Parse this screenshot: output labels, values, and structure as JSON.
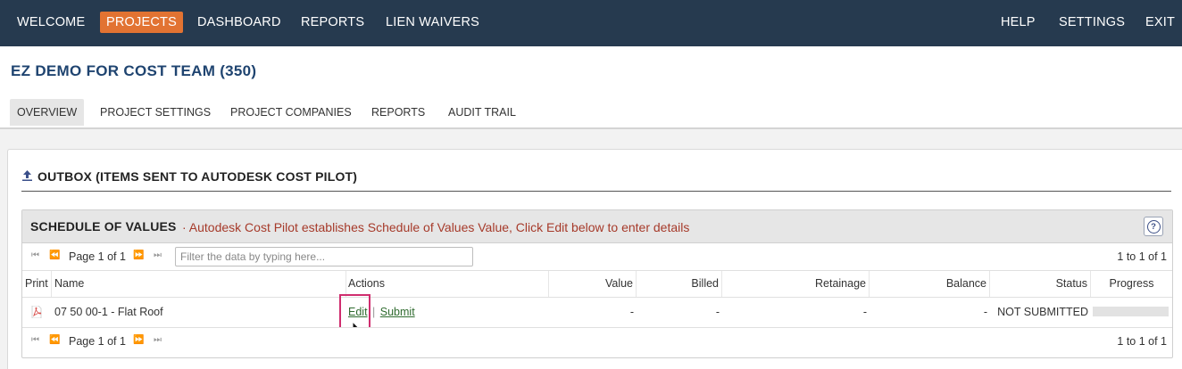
{
  "topnav": {
    "items": [
      {
        "label": "WELCOME",
        "active": false
      },
      {
        "label": "PROJECTS",
        "active": true
      },
      {
        "label": "DASHBOARD",
        "active": false
      },
      {
        "label": "REPORTS",
        "active": false
      },
      {
        "label": "LIEN WAIVERS",
        "active": false
      }
    ],
    "right_items": [
      {
        "label": "HELP"
      },
      {
        "label": "SETTINGS"
      },
      {
        "label": "EXIT"
      }
    ],
    "bg_color": "#263a4f",
    "active_color": "#e27332"
  },
  "project": {
    "title": "EZ DEMO FOR COST TEAM (350)"
  },
  "subtabs": [
    {
      "label": "OVERVIEW",
      "active": true
    },
    {
      "label": "PROJECT SETTINGS",
      "active": false
    },
    {
      "label": "PROJECT COMPANIES",
      "active": false
    },
    {
      "label": "REPORTS",
      "active": false
    },
    {
      "label": "AUDIT TRAIL",
      "active": false
    }
  ],
  "outbox": {
    "icon": "upload-icon",
    "title": "OUTBOX (ITEMS SENT TO AUTODESK COST PILOT)"
  },
  "sov": {
    "title": "SCHEDULE OF VALUES",
    "description": "· Autodesk Cost Pilot establishes Schedule of Values Value, Click Edit below to enter details",
    "help_icon": "question-circle-icon",
    "pager": {
      "page_label": "Page 1 of 1",
      "range_label": "1 to 1 of 1",
      "filter_placeholder": "Filter the data by typing here...",
      "filter_value": ""
    },
    "columns": [
      {
        "key": "print",
        "label": "Print"
      },
      {
        "key": "name",
        "label": "Name"
      },
      {
        "key": "actions",
        "label": "Actions"
      },
      {
        "key": "value",
        "label": "Value"
      },
      {
        "key": "billed",
        "label": "Billed"
      },
      {
        "key": "retainage",
        "label": "Retainage"
      },
      {
        "key": "balance",
        "label": "Balance"
      },
      {
        "key": "status",
        "label": "Status"
      },
      {
        "key": "progress",
        "label": "Progress"
      }
    ],
    "rows": [
      {
        "print_icon": "pdf-icon",
        "name": "07 50 00-1 - Flat Roof",
        "edit_label": "Edit",
        "separator": "|",
        "submit_label": "Submit",
        "value": "-",
        "billed": "-",
        "retainage": "-",
        "balance": "-",
        "status": "NOT SUBMITTED",
        "progress": 0
      }
    ]
  },
  "highlight_color": "#cf2d6e"
}
